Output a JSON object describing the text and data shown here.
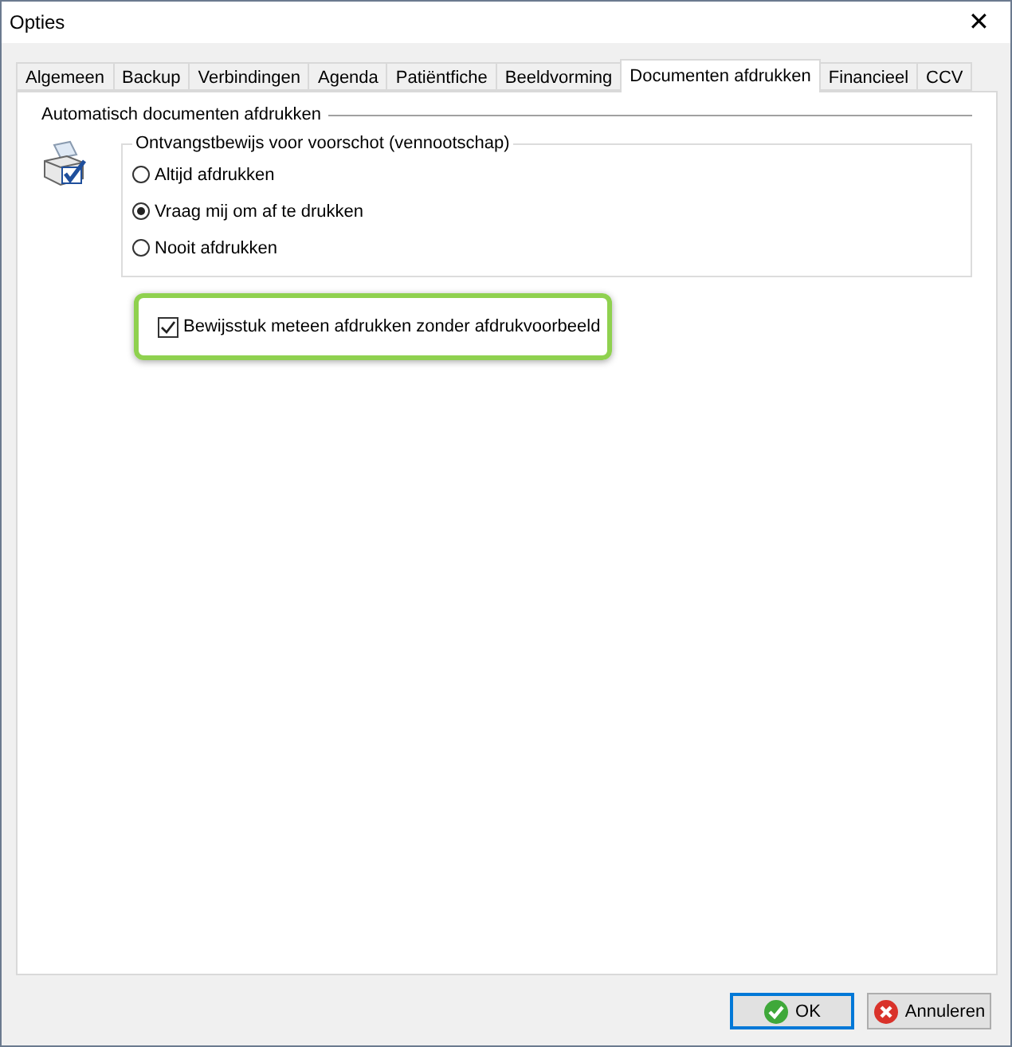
{
  "window": {
    "title": "Opties",
    "close": "✕"
  },
  "tabs": [
    {
      "label": "Algemeen",
      "selected": false
    },
    {
      "label": "Backup",
      "selected": false
    },
    {
      "label": "Verbindingen",
      "selected": false
    },
    {
      "label": "Agenda",
      "selected": false
    },
    {
      "label": "Patiëntfiche",
      "selected": false
    },
    {
      "label": "Beeldvorming",
      "selected": false
    },
    {
      "label": "Documenten afdrukken",
      "selected": true
    },
    {
      "label": "Financieel",
      "selected": false
    },
    {
      "label": "CCV",
      "selected": false
    }
  ],
  "section": {
    "title": "Automatisch documenten afdrukken"
  },
  "group": {
    "title": "Ontvangstbewijs voor voorschot (vennootschap)",
    "options": [
      {
        "label": "Altijd afdrukken",
        "selected": false
      },
      {
        "label": "Vraag mij om af te drukken",
        "selected": true
      },
      {
        "label": "Nooit afdrukken",
        "selected": false
      }
    ]
  },
  "checkbox": {
    "label": "Bewijsstuk meteen afdrukken zonder afdrukvoorbeeld",
    "checked": true,
    "highlighted": true
  },
  "buttons": [
    {
      "label": "OK",
      "kind": "ok",
      "default": true
    },
    {
      "label": "Annuleren",
      "kind": "cancel",
      "default": false
    }
  ]
}
